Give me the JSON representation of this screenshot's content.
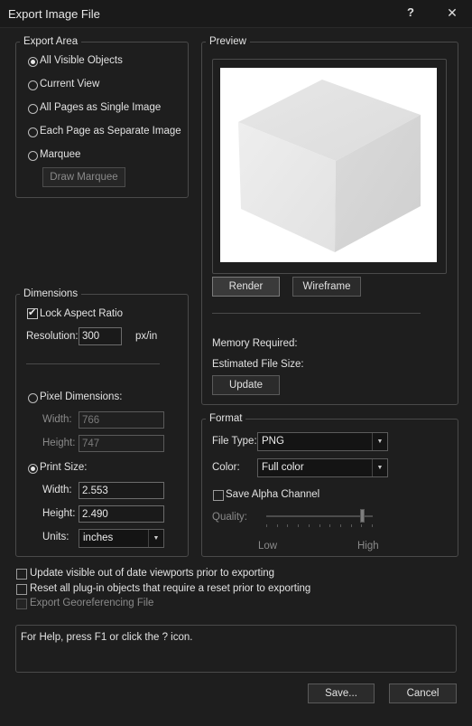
{
  "window": {
    "title": "Export Image File",
    "help_label": "?",
    "close_label": "✕"
  },
  "export_area": {
    "legend": "Export Area",
    "options": [
      "All Visible Objects",
      "Current View",
      "All Pages as Single Image",
      "Each Page as Separate Image",
      "Marquee"
    ],
    "selected": "All Visible Objects",
    "draw_marquee_label": "Draw Marquee"
  },
  "preview": {
    "legend": "Preview",
    "render_label": "Render",
    "wireframe_label": "Wireframe",
    "memory_label": "Memory Required:",
    "file_size_label": "Estimated File Size:",
    "update_label": "Update"
  },
  "dimensions": {
    "legend": "Dimensions",
    "lock_aspect_label": "Lock Aspect Ratio",
    "lock_aspect_checked": true,
    "resolution_label": "Resolution:",
    "resolution_value": "300",
    "resolution_unit": "px/in",
    "pixel_dimensions_label": "Pixel Dimensions:",
    "pixel_width_label": "Width:",
    "pixel_width_value": "766",
    "pixel_height_label": "Height:",
    "pixel_height_value": "747",
    "print_size_label": "Print Size:",
    "print_width_label": "Width:",
    "print_width_value": "2.553",
    "print_height_label": "Height:",
    "print_height_value": "2.490",
    "units_label": "Units:",
    "units_value": "inches"
  },
  "format": {
    "legend": "Format",
    "file_type_label": "File Type:",
    "file_type_value": "PNG",
    "color_label": "Color:",
    "color_value": "Full color",
    "alpha_label": "Save Alpha Channel",
    "quality_label": "Quality:",
    "quality_low": "Low",
    "quality_high": "High",
    "quality_level": 0.9
  },
  "options": {
    "update_viewports": "Update visible out of date viewports prior to exporting",
    "reset_plugins": "Reset all plug-in objects that require a reset prior to exporting",
    "export_georef": "Export Georeferencing File"
  },
  "help_text": "For Help, press F1 or click the ? icon.",
  "footer": {
    "save_label": "Save...",
    "cancel_label": "Cancel"
  }
}
